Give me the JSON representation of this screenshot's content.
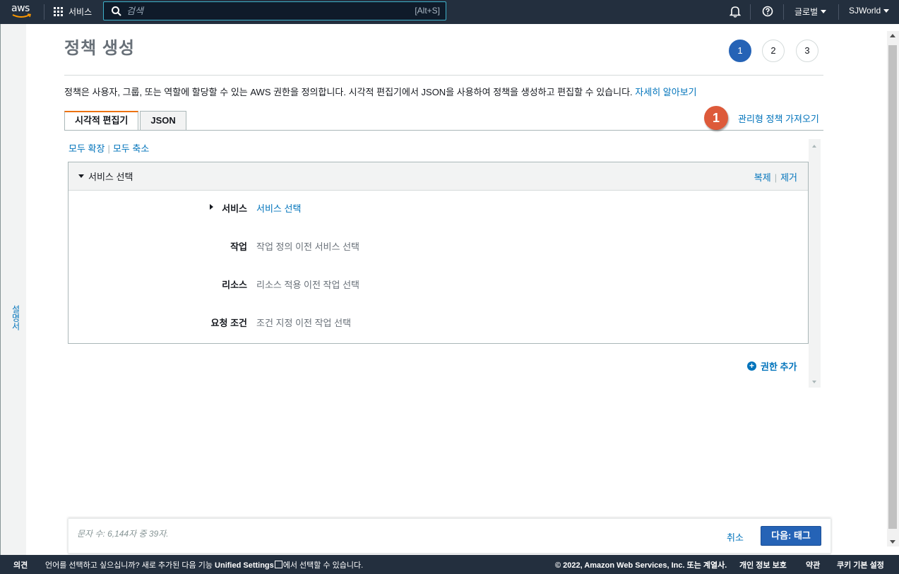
{
  "nav": {
    "logo_text": "aws",
    "services_label": "서비스",
    "search_placeholder": "검색",
    "search_shortcut": "[Alt+S]",
    "region": "글로벌",
    "account": "SJWorld"
  },
  "left_rail": {
    "label": "설명서"
  },
  "page": {
    "title": "정책 생성",
    "steps": [
      "1",
      "2",
      "3"
    ],
    "active_step": "1",
    "description": "정책은 사용자, 그룹, 또는 역할에 할당할 수 있는 AWS 권한을 정의합니다. 시각적 편집기에서 JSON을 사용하여 정책을 생성하고 편집할 수 있습니다. ",
    "learn_more": "자세히 알아보기",
    "tabs": [
      {
        "label": "시각적 편집기"
      },
      {
        "label": "JSON"
      }
    ],
    "annotation_number": "1",
    "import_managed_policy": "관리형 정책 가져오기",
    "expand_all": "모두 확장",
    "collapse_all": "모두 축소"
  },
  "panel": {
    "title": "서비스 선택",
    "duplicate": "복제",
    "remove": "제거",
    "rows": [
      {
        "label": "서비스",
        "value": "서비스 선택"
      },
      {
        "label": "작업",
        "value": "작업 정의 이전 서비스 선택"
      },
      {
        "label": "리소스",
        "value": "리소스 적용 이전 작업 선택"
      },
      {
        "label": "요청 조건",
        "value": "조건 지정 이전 작업 선택"
      }
    ]
  },
  "add_permission": "권한 추가",
  "footer": {
    "char_count": "문자 수: 6,144자 중 39자.",
    "cancel": "취소",
    "next": "다음: 태그"
  },
  "bottom": {
    "feedback": "의견",
    "lang_prompt_pre": "언어를 선택하고 싶으십니까? 새로 추가된 다음 기능 ",
    "unified_settings": "Unified Settings",
    "lang_prompt_post": "에서 선택할 수 있습니다.",
    "copyright": "© 2022, Amazon Web Services, Inc. 또는 계열사.",
    "privacy": "개인 정보 보호",
    "terms": "약관",
    "cookie": "쿠키 기본 설정"
  }
}
